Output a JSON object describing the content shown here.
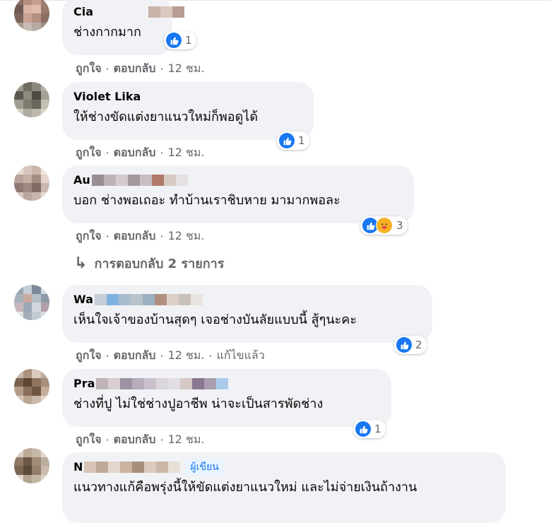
{
  "colors": {
    "link": "#1877f2",
    "meta": "#65676b",
    "bubble": "#f0f2f5"
  },
  "actions": {
    "like": "ถูกใจ",
    "reply": "ตอบกลับ",
    "dot": "·",
    "edited": "แก้ไขแล้ว"
  },
  "comments": [
    {
      "name": "Cia",
      "text": "ช่างกากมาก",
      "time": "12 ชม.",
      "reactions": [
        "like"
      ],
      "reaction_count": "1"
    },
    {
      "name": "Violet Lika",
      "text": "ให้ช่างขัดแต่งยาแนวใหม่ก็พอดูได้",
      "time": "12 ชม.",
      "reactions": [
        "like"
      ],
      "reaction_count": "1"
    },
    {
      "name": "Au",
      "text": "บอก ช่างพอเถอะ ทำบ้านเราชิบหาย มามากพอละ",
      "time": "12 ชม.",
      "reactions": [
        "like",
        "care"
      ],
      "reaction_count": "3"
    },
    {
      "name": "Wa",
      "text": "เห็นใจเจ้าของบ้านสุดๆ เจอช่างบันลัยแบบนี้ สู้ๆนะคะ",
      "time": "12 ชม.",
      "edited": true,
      "reactions": [
        "like"
      ],
      "reaction_count": "2"
    },
    {
      "name": "Pra",
      "text": "ช่างที่ปู ไม่ใช่ช่างปูอาชีพ น่าจะเป็นสารพัดช่าง",
      "time": "12 ชม.",
      "reactions": [
        "like"
      ],
      "reaction_count": "1"
    },
    {
      "name": "N",
      "author_badge": "ผู้เขียน",
      "text": "แนวทางแก้คือพรุ่งนี้ให้ขัดแต่งยาแนวใหม่ และไม่จ่ายเงินถ้างาน"
    }
  ],
  "replies_link": {
    "arrow": "↳",
    "label": "การตอบกลับ 2 รายการ"
  }
}
